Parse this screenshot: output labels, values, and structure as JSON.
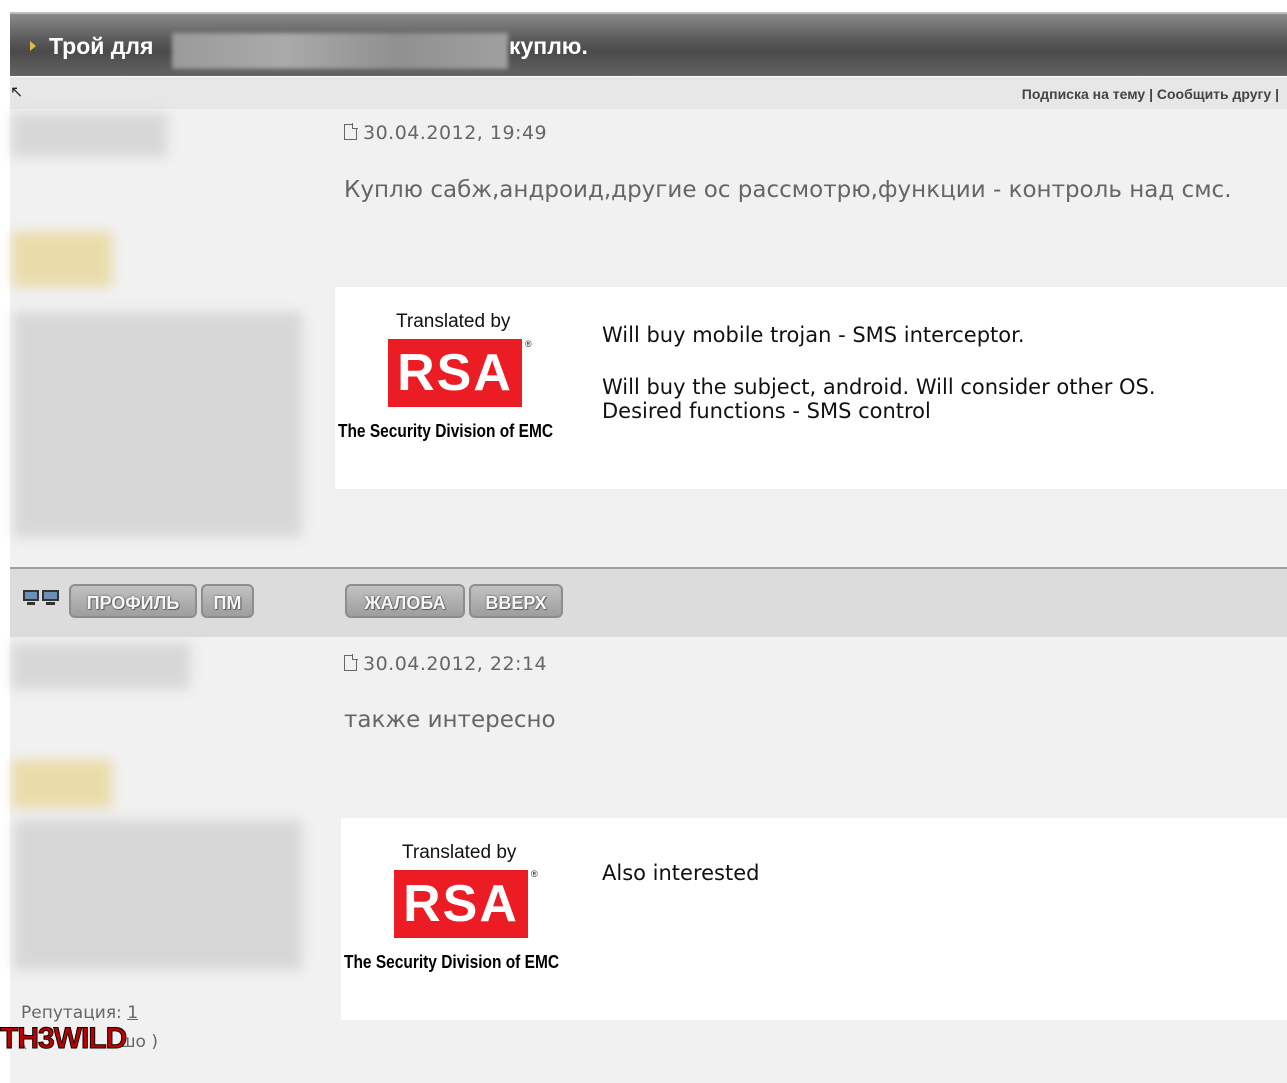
{
  "topic": {
    "title_prefix": "Трой для",
    "title_suffix": "куплю.",
    "links": "Подписка на тему | Сообщить другу |"
  },
  "posts": [
    {
      "date": "30.04.2012, 19:49",
      "message": "Куплю сабж,андроид,другие ос рассмотрю,функции - контроль над смс.",
      "translation": {
        "translated_by": "Translated by",
        "logo": "RSA",
        "tagline": "The Security Division of EMC",
        "line1": "Will buy mobile trojan - SMS interceptor.",
        "line2": "Will buy the subject, android. Will consider other OS.",
        "line3": "Desired functions - SMS control"
      }
    },
    {
      "date": "30.04.2012, 22:14",
      "message": "также интересно",
      "translation": {
        "translated_by": "Translated by",
        "logo": "RSA",
        "tagline": "The Security Division of EMC",
        "line1": "Also interested"
      }
    }
  ],
  "buttons": {
    "profile": "ПРОФИЛЬ",
    "pm": "ПМ",
    "report": "ЖАЛОБА",
    "up": "ВВЕРХ"
  },
  "reputation": {
    "label": "Репутация:",
    "value": "1",
    "tail": "шо )",
    "open": "("
  },
  "watermark": "TH3WILD",
  "colors": {
    "rsa_red": "#ec1c24",
    "title_bar": "#5c5c5c",
    "watermark": "#c00000"
  }
}
